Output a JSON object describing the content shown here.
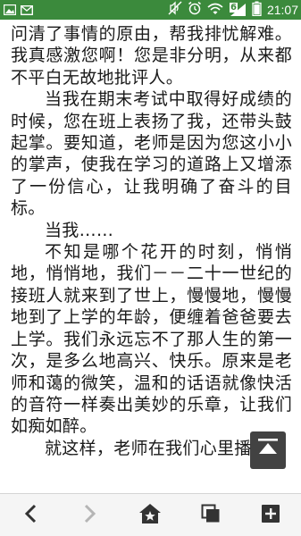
{
  "status_bar": {
    "time": "21:07",
    "signal_badge": "6",
    "icons": [
      "image-icon",
      "mail-icon",
      "mute-icon",
      "alarm-icon",
      "wifi-icon",
      "signal-icon",
      "battery-icon"
    ]
  },
  "article": {
    "paragraphs": [
      "问清了事情的原由，帮我排忧解难。我真感激您啊！您是非分明，从来都不平白无故地批评人。",
      "当我在期末考试中取得好成绩的时候，您在班上表扬了我，还带头鼓起掌。要知道，老师是因为您这小小的掌声，使我在学习的道路上又增添了一份信心，让我明确了奋斗的目标。",
      "当我……",
      "不知是哪个花开的时刻，悄悄地，悄悄地，我们－－二十一世纪的接班人就来到了世上，慢慢地，慢慢地到了上学的年龄，便缠着爸爸要去上学。我们永远忘不了那人生的第一次，是多么地高兴、快乐。原来是老师和蔼的微笑，温和的话语就像快活的音符一样奏出美妙的乐章，让我们如痴如醉。",
      "就这样，老师在我们心里播"
    ]
  },
  "back_to_top": {
    "icon": "arrow-up-to-top-icon"
  },
  "toolbar": {
    "buttons": [
      "back-arrow-icon",
      "forward-arrow-icon",
      "home-star-icon",
      "tabs-icon",
      "plus-icon"
    ]
  }
}
